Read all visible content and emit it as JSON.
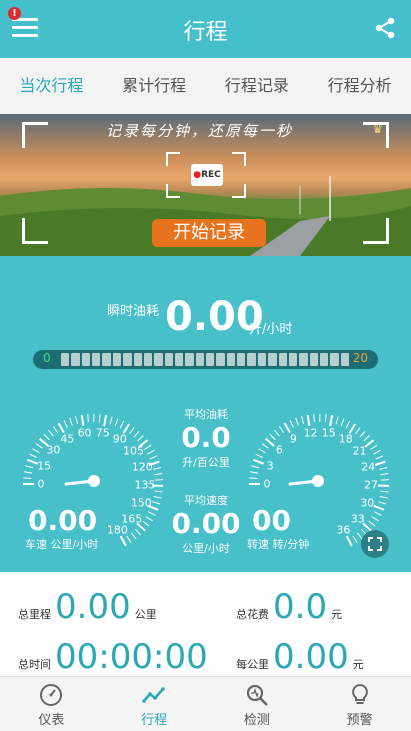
{
  "header": {
    "title": "行程",
    "notification_count": "!"
  },
  "tabs": [
    {
      "label": "当次行程",
      "active": true
    },
    {
      "label": "累计行程",
      "active": false
    },
    {
      "label": "行程记录",
      "active": false
    },
    {
      "label": "行程分析",
      "active": false
    }
  ],
  "banner": {
    "slogan": "记录每分钟，还原每一秒",
    "rec_badge": "REC",
    "start_button": "开始记录"
  },
  "instant": {
    "label": "瞬时油耗",
    "value": "0.00",
    "unit": "升/小时"
  },
  "fuel_bar": {
    "min": "0",
    "max": "20",
    "level": 0
  },
  "speed_gauge": {
    "ticks": [
      "0",
      "15",
      "30",
      "45",
      "60",
      "75",
      "90",
      "105",
      "120",
      "135",
      "150",
      "165",
      "180"
    ],
    "value": "0.00",
    "caption_label": "车速",
    "caption_unit": "公里/小时"
  },
  "rpm_gauge": {
    "ticks": [
      "0",
      "3",
      "6",
      "9",
      "12",
      "15",
      "18",
      "21",
      "24",
      "27",
      "30",
      "33",
      "36"
    ],
    "value": "00",
    "caption_label": "转速",
    "caption_unit": "转/分钟"
  },
  "avg_fuel": {
    "label": "平均油耗",
    "value": "0.0",
    "unit": "升/百公里"
  },
  "avg_speed": {
    "label": "平均速度",
    "value": "0.00",
    "unit": "公里/小时"
  },
  "summary": {
    "total_distance": {
      "label": "总里程",
      "value": "0.00",
      "unit": "公里"
    },
    "total_cost": {
      "label": "总花费",
      "value": "0.0",
      "unit": "元"
    },
    "total_time": {
      "label": "总时间",
      "value": "00:00:00"
    },
    "per_km": {
      "label": "每公里",
      "value": "0.00",
      "unit": "元"
    }
  },
  "bottom_nav": [
    {
      "label": "仪表",
      "icon": "gauge-icon",
      "active": false
    },
    {
      "label": "行程",
      "icon": "trend-icon",
      "active": true
    },
    {
      "label": "检测",
      "icon": "scan-icon",
      "active": false
    },
    {
      "label": "预警",
      "icon": "bulb-icon",
      "active": false
    }
  ],
  "colors": {
    "header": "#45bfca",
    "accent": "#2aa8b5",
    "start_button": "#e8731f",
    "badge": "#e12a2a"
  }
}
